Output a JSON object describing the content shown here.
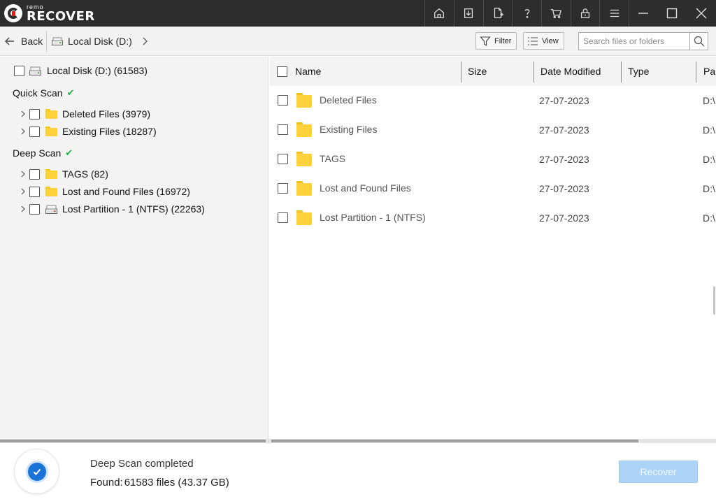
{
  "app": {
    "logo_small": "remo",
    "logo_big": "RECOVER"
  },
  "titlebar": {
    "icons": [
      "home-icon",
      "download-icon",
      "add-file-icon",
      "help-icon",
      "cart-icon",
      "lock-icon",
      "menu-icon"
    ],
    "window_controls": [
      "minimize-icon",
      "maximize-icon",
      "close-icon"
    ]
  },
  "toolbar": {
    "back_label": "Back",
    "breadcrumb": "Local Disk (D:)",
    "filter_label": "Filter",
    "view_label": "View",
    "search_placeholder": "Search files or folders"
  },
  "tree": {
    "root_label": "Local Disk (D:) (61583)",
    "quick_scan": {
      "title": "Quick Scan",
      "items": [
        {
          "label": "Deleted Files (3979)"
        },
        {
          "label": "Existing Files (18287)"
        }
      ]
    },
    "deep_scan": {
      "title": "Deep Scan",
      "items": [
        {
          "label": "TAGS (82)"
        },
        {
          "label": "Lost and Found Files (16972)"
        },
        {
          "label": "Lost Partition - 1 (NTFS) (22263)"
        }
      ]
    }
  },
  "list": {
    "columns": {
      "name": "Name",
      "size": "Size",
      "date": "Date Modified",
      "type": "Type",
      "path": "Pa"
    },
    "rows": [
      {
        "name": "Deleted Files",
        "date": "27-07-2023",
        "path": "D:\\"
      },
      {
        "name": "Existing Files",
        "date": "27-07-2023",
        "path": "D:\\"
      },
      {
        "name": "TAGS",
        "date": "27-07-2023",
        "path": "D:\\"
      },
      {
        "name": "Lost and Found Files",
        "date": "27-07-2023",
        "path": "D:\\"
      },
      {
        "name": "Lost Partition - 1 (NTFS)",
        "date": "27-07-2023",
        "path": "D:\\"
      }
    ]
  },
  "footer": {
    "status_title": "Deep Scan completed",
    "found_label": "Found:",
    "found_value": "61583 files (43.37 GB)",
    "recover_label": "Recover"
  },
  "colors": {
    "titlebar_bg": "#2d2d2d",
    "accent": "#1a73d6",
    "check_green": "#1fae4b",
    "folder_yellow": "#ffd23c",
    "recover_disabled": "#acd4f6"
  }
}
